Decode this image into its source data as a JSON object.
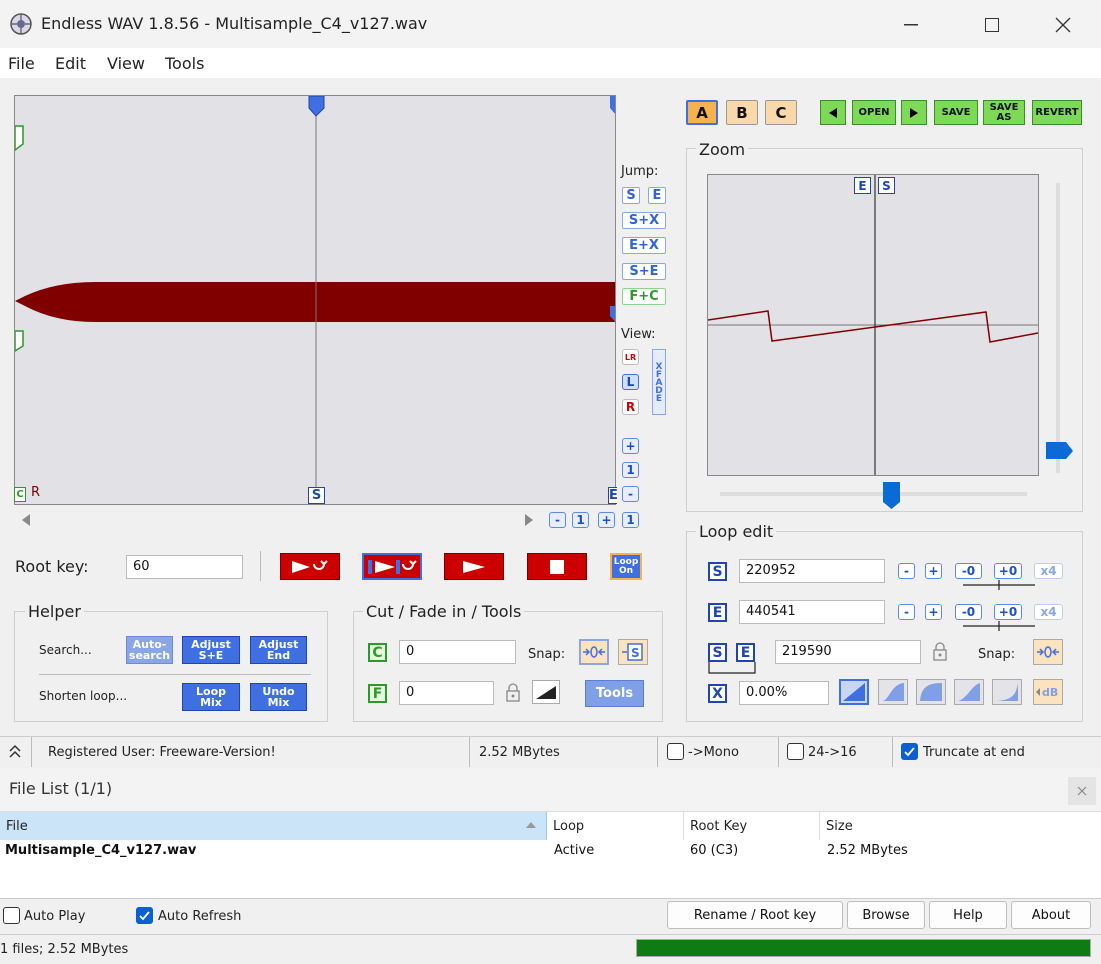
{
  "window": {
    "title": "Endless WAV 1.8.56 - Multisample_C4_v127.wav"
  },
  "menu": [
    "File",
    "Edit",
    "View",
    "Tools"
  ],
  "wave": {
    "start_marker": "S",
    "end_marker": "E",
    "channel_label": "R",
    "colors": {
      "wave": "#800000",
      "bg": "#e2e2e6"
    },
    "scroll_buttons": [
      "-",
      "1",
      "+",
      "1"
    ]
  },
  "jump": {
    "label": "Jump:",
    "buttons": [
      "S",
      "E",
      "S+X",
      "E+X",
      "S+E",
      "F+C"
    ]
  },
  "view": {
    "label": "View:",
    "buttons": [
      "LR",
      "L",
      "R"
    ],
    "xfade": "XFADE",
    "zoom_buttons": [
      "+",
      "1",
      "-"
    ]
  },
  "toolbar": {
    "abc": [
      "A",
      "B",
      "C"
    ],
    "open": "OPEN",
    "save": "SAVE",
    "save_as_1": "SAVE",
    "save_as_2": "AS",
    "revert": "REVERT"
  },
  "zoom": {
    "title": "Zoom",
    "markers": [
      "E",
      "S"
    ]
  },
  "root": {
    "label": "Root key:",
    "value": "60",
    "loop_on_1": "Loop",
    "loop_on_2": "On"
  },
  "helper": {
    "title": "Helper",
    "search_label": "Search...",
    "shorten_label": "Shorten loop...",
    "auto_search_1": "Auto-",
    "auto_search_2": "search",
    "adjust_se_1": "Adjust",
    "adjust_se_2": "S+E",
    "adjust_end_1": "Adjust",
    "adjust_end_2": "End",
    "loop_mix_1": "Loop",
    "loop_mix_2": "Mix",
    "undo_mix_1": "Undo",
    "undo_mix_2": "Mix"
  },
  "cutfade": {
    "title": "Cut / Fade in / Tools",
    "c_label": "C",
    "c_value": "0",
    "f_label": "F",
    "f_value": "0",
    "snap": "Snap:",
    "tools": "Tools"
  },
  "loopedit": {
    "title": "Loop edit",
    "s_label": "S",
    "s_value": "220952",
    "e_label": "E",
    "e_value": "440541",
    "se_value": "219590",
    "x_label": "X",
    "x_value": "0.00%",
    "snap": "Snap:",
    "minus": "-",
    "plus": "+",
    "m0": "-0",
    "p0": "+0",
    "x4": "x4"
  },
  "status": {
    "user": "Registered User: Freeware-Version!",
    "size": "2.52 MBytes",
    "mono": "->Mono",
    "bits": "24->16",
    "truncate": "Truncate at end",
    "mono_checked": false,
    "bits_checked": false,
    "truncate_checked": true
  },
  "filelist": {
    "title": "File List (1/1)",
    "columns": [
      "File",
      "Loop",
      "Root Key",
      "Size"
    ],
    "rows": [
      {
        "file": "Multisample_C4_v127.wav",
        "loop": "Active",
        "root": "60 (C3)",
        "size": "2.52 MBytes"
      }
    ],
    "auto_play": "Auto Play",
    "auto_refresh": "Auto Refresh",
    "auto_play_checked": false,
    "auto_refresh_checked": true,
    "buttons": [
      "Rename / Root key",
      "Browse",
      "Help",
      "About"
    ],
    "footer": "1 files; 2.52 MBytes",
    "progress": 1.0
  }
}
